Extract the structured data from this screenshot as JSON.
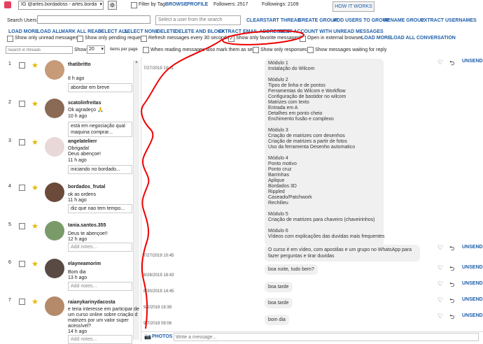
{
  "top": {
    "account": "IG @artes.bordadoss - artes.bordadc",
    "filter_label": "Filter by Tag",
    "browse": "BROWSE",
    "profile": "PROFILE",
    "followers": "Followers: 2517",
    "followings": "Followings: 2109",
    "how_it_works": "HOW IT WORKS"
  },
  "search_users": {
    "label": "Search Users",
    "select_placeholder": "Select a user from the search"
  },
  "actions_row1": [
    "CLEAR",
    "START THREAD",
    "CREATE GROUP",
    "ADD USERS TO GROUP",
    "RENAME GROUP",
    "EXTRACT USERNAMES"
  ],
  "actions_row2": [
    "LOAD MORE",
    "LOAD ALL",
    "MARK ALL READ",
    "SELECT ALL",
    "SELECT NONE",
    "DELETE",
    "DELETE AND BLOCK",
    "EXTRACT EMAIL ADDRESSES",
    "NEXT ACCOUNT WITH UNREAD MESSAGES"
  ],
  "options_row": {
    "unread": "Show only unread messages",
    "pending": "Show only pending requests",
    "refresh": "Refresh messages every 30 seconds",
    "favorite": "Show only favorite messages",
    "external": "Open in external browser",
    "load_more": "LOAD MORE",
    "load_all_conv": "LOAD ALL CONVERSATION"
  },
  "options_row2": {
    "search_placeholder": "Search in threads",
    "show": "Show",
    "per_page_value": "20",
    "items_per_page": "items per page",
    "mark_seen": "When reading messages also mark them as seen",
    "responses": "Show only responses",
    "waiting": "Show messages waiting for reply"
  },
  "threads": [
    {
      "num": "1",
      "name": "thatibritto",
      "msg": [
        "",
        "8 h ago"
      ],
      "note": "abordar em breve"
    },
    {
      "num": "2",
      "name": "scatolinfreitas",
      "msg": [
        "Ok agradeço 🙏",
        "10 h ago"
      ],
      "note": "está em negociação qual maquina comprar..."
    },
    {
      "num": "3",
      "name": "angelatelierr",
      "msg": [
        "Obrigada!",
        "Deus abençoe!",
        "11 h ago"
      ],
      "note": "iniciando no bordado..."
    },
    {
      "num": "4",
      "name": "bordados_frutal",
      "msg": [
        "ok as ordens",
        "11 h ago"
      ],
      "note": "diz que nao tem tempo..."
    },
    {
      "num": "5",
      "name": "tania.santos.355",
      "msg": [
        "Deus te abençoe!!",
        "12 h ago"
      ],
      "note": "Add notes..."
    },
    {
      "num": "6",
      "name": "elayneamorim",
      "msg": [
        "Bom dia",
        "13 h ago"
      ],
      "note": "Add notes..."
    },
    {
      "num": "7",
      "name": "raianykarinydacosta",
      "msg": [
        "e teria interesse em participar de",
        "um curso online sobre criação d",
        "matrizes por um valor super",
        "acessível?",
        "14 h ago"
      ],
      "note": "Add notes..."
    }
  ],
  "module_text": [
    "Módulo 1",
    "Instalação do Wilcom",
    "",
    "Módulo 2",
    "Tipos de linha e de pontos",
    "Ferramentas do Wilcom e Workflow",
    "Configuração de bastidor no wilcom",
    "Matrizes com texto",
    "Entrada em A",
    "Detalhes em ponto cheio",
    "Enchimento fusão e complexo",
    "",
    "Módulo 3",
    "Criação de matrizes com desenhos",
    "Criação de matrizes a partir de fotos",
    "Uso da ferramenta Desenho automatico",
    "",
    "Módulo 4",
    "Ponto motivo",
    "Ponto cruz",
    "Barrinhas",
    "Aplique",
    "Bordados 3D",
    "Rippled",
    "Caseado/Patchwork",
    "Rechilieu",
    "",
    "Módulo 5",
    "Criação de matrizes para chaveiro (chaveirinhos)",
    "",
    "Módulo 6",
    "Vídeos com explicações das duvidas mais frequentes"
  ],
  "messages": [
    {
      "ts": "7/27/2019 10:41",
      "text": ""
    },
    {
      "ts": "7/27/2019 10:45",
      "text": "O curso é em vídeo, com apostilas e um grupo no WhatsApp para fazer perguntas e tirar duvidas"
    },
    {
      "ts": "8/28/2019 18:43",
      "text": "boa noite, tudo bem?"
    },
    {
      "ts": "8/30/2019 14:45",
      "text": "boa tarde"
    },
    {
      "ts": "9/2/2019 18:38",
      "text": "boa tarde"
    },
    {
      "ts": "9/7/2019 09:06",
      "text": "bom dia"
    }
  ],
  "unsend": "UNSEND",
  "composer": {
    "photos": "PHOTOS",
    "placeholder": "Write a message..."
  }
}
